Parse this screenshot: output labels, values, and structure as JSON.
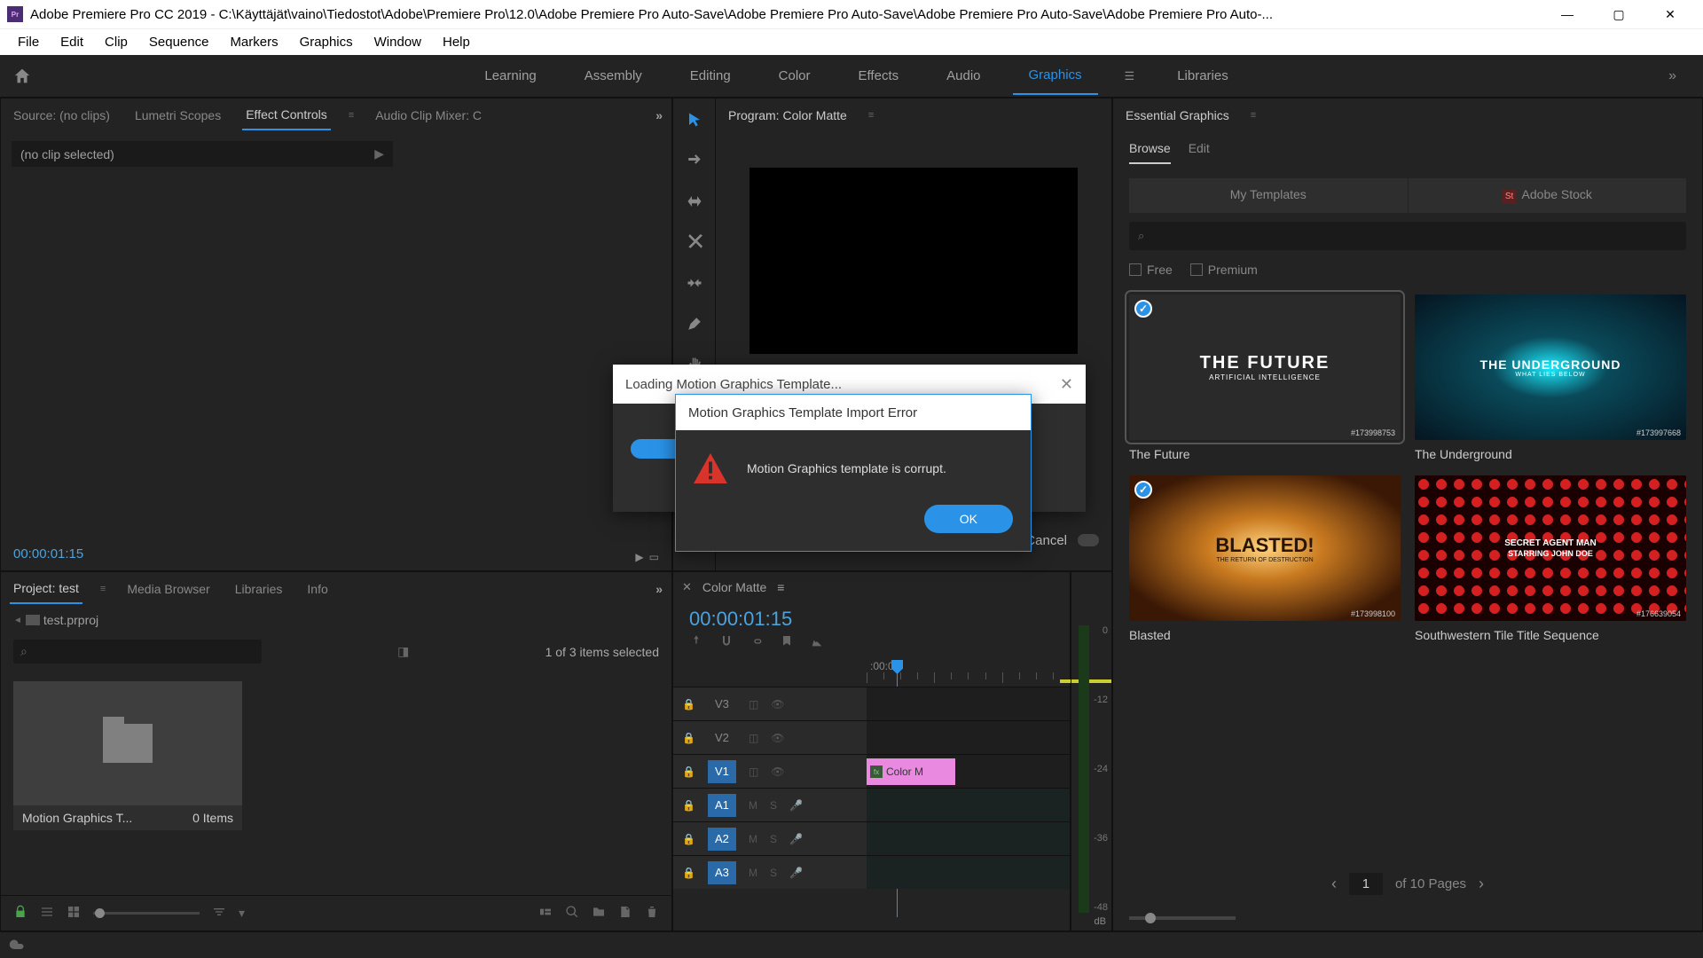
{
  "title_bar": {
    "app_abbr": "Pr",
    "title": "Adobe Premiere Pro CC 2019 - C:\\Käyttäjät\\vaino\\Tiedostot\\Adobe\\Premiere Pro\\12.0\\Adobe Premiere Pro Auto-Save\\Adobe Premiere Pro Auto-Save\\Adobe Premiere Pro Auto-Save\\Adobe Premiere Pro Auto-..."
  },
  "menu": [
    "File",
    "Edit",
    "Clip",
    "Sequence",
    "Markers",
    "Graphics",
    "Window",
    "Help"
  ],
  "workspaces": [
    "Learning",
    "Assembly",
    "Editing",
    "Color",
    "Effects",
    "Audio",
    "Graphics",
    "Libraries"
  ],
  "workspace_active": "Graphics",
  "source_panel": {
    "tabs": [
      "Source: (no clips)",
      "Lumetri Scopes",
      "Effect Controls",
      "Audio Clip Mixer: C"
    ],
    "active_tab": "Effect Controls",
    "no_clip": "(no clip selected)",
    "timecode": "00:00:01:15"
  },
  "program_panel": {
    "title": "Program: Color Matte",
    "percent": "%",
    "cancel": "Cancel"
  },
  "essential_graphics": {
    "title": "Essential Graphics",
    "tabs": [
      "Browse",
      "Edit"
    ],
    "active_tab": "Browse",
    "buttons": {
      "my_templates": "My Templates",
      "adobe_stock": "Adobe Stock",
      "stock_abbr": "St"
    },
    "search_placeholder": "⌕",
    "filters": {
      "free": "Free",
      "premium": "Premium"
    },
    "templates": [
      {
        "name": "The Future",
        "title_main": "THE FUTURE",
        "subtitle": "ARTIFICIAL INTELLIGENCE",
        "checked": true,
        "selected": true,
        "id": "#173998753"
      },
      {
        "name": "The Underground",
        "title_main": "THE UNDERGROUND",
        "subtitle": "WHAT LIES BELOW",
        "checked": false,
        "selected": false,
        "id": "#173997668"
      },
      {
        "name": "Blasted",
        "title_main": "BLASTED!",
        "subtitle": "THE RETURN OF DESTRUCTION",
        "checked": true,
        "selected": false,
        "id": "#173998100"
      },
      {
        "name": "Southwestern Tile Title Sequence",
        "title_main": "SECRET AGENT MAN",
        "subtitle": "STARRING JOHN DOE",
        "checked": false,
        "selected": false,
        "id": "#176639054"
      }
    ],
    "pagination": {
      "page": "1",
      "total_text": "of 10 Pages"
    }
  },
  "project_panel": {
    "tabs": [
      "Project: test",
      "Media Browser",
      "Libraries",
      "Info"
    ],
    "active_tab": "Project: test",
    "project_file": "test.prproj",
    "count_text": "1 of 3 items selected",
    "item_name": "Motion Graphics T...",
    "item_count": "0 Items"
  },
  "timeline": {
    "sequence_name": "Color Matte",
    "timecode": "00:00:01:15",
    "ruler_label": ":00:00",
    "video_tracks": [
      "V3",
      "V2",
      "V1"
    ],
    "audio_tracks": [
      "A1",
      "A2",
      "A3"
    ],
    "clip_name": "Color M",
    "meter_values": [
      "0",
      "-12",
      "-24",
      "-36",
      "-48"
    ],
    "meter_db": "dB"
  },
  "dialogs": {
    "loading_title": "Loading Motion Graphics Template...",
    "error_title": "Motion Graphics Template Import Error",
    "error_msg": "Motion Graphics template is corrupt.",
    "ok": "OK"
  }
}
